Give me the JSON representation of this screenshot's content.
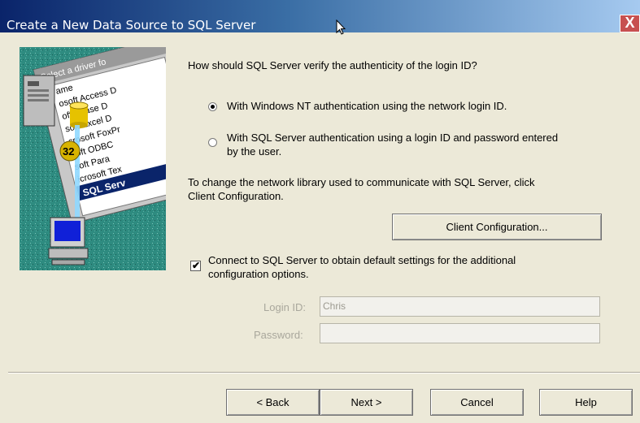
{
  "window": {
    "title": "Create a New Data Source to SQL Server",
    "close_symbol": "X"
  },
  "illustration": {
    "header": "Select a driver fo",
    "list_header": "ame",
    "drivers": [
      "osoft Access D",
      "oft dBase D",
      "soft Excel D",
      "crosoft FoxPr",
      "soft ODBC",
      "soft Para",
      "icrosoft Tex",
      "SQL Serv"
    ],
    "badge": "32"
  },
  "auth": {
    "question": "How should SQL Server verify the authenticity of the login ID?",
    "option_windows": "With Windows NT authentication using the network login ID.",
    "option_sql_line1": "With SQL Server authentication using a login ID and password entered",
    "option_sql_line2": "by the user.",
    "selected": "windows"
  },
  "network": {
    "text_line1": "To change the network library used to communicate with SQL Server, click",
    "text_line2": "Client Configuration.",
    "client_config_button": "Client Configuration..."
  },
  "connect": {
    "checked": true,
    "check_symbol": "✔",
    "label_line1": "Connect to SQL Server to obtain default settings for the additional",
    "label_line2": "configuration options."
  },
  "login": {
    "login_id_label": "Login ID:",
    "login_id_value": "Chris",
    "password_label": "Password:",
    "password_value": ""
  },
  "buttons": {
    "back": "< Back",
    "next": "Next >",
    "cancel": "Cancel",
    "help": "Help"
  }
}
